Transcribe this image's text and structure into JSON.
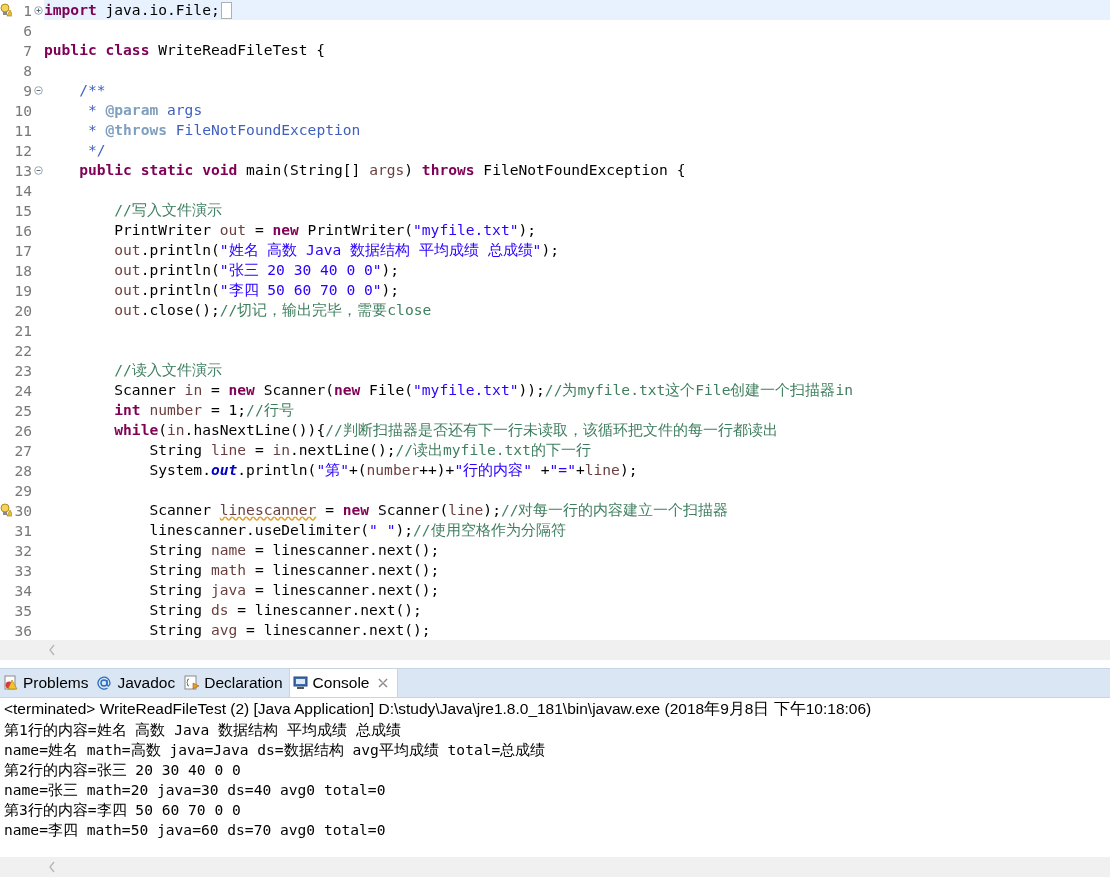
{
  "editor": {
    "lines": [
      {
        "number": "1",
        "folded": true,
        "current": true,
        "warning": true,
        "tokens": [
          {
            "kind": "keyword",
            "text": "import"
          },
          {
            "kind": "plain",
            "text": " java.io.File;"
          }
        ]
      },
      {
        "number": "6",
        "current": false,
        "warning": false
      },
      {
        "number": "7",
        "current": false,
        "warning": false,
        "tokens": [
          {
            "kind": "keyword",
            "text": "public"
          },
          {
            "kind": "keyword",
            "text": " class"
          },
          {
            "kind": "plain",
            "text": " WriteReadFileTest {"
          }
        ]
      },
      {
        "number": "8",
        "current": false,
        "warning": false
      },
      {
        "number": "9",
        "folded": false,
        "current": false,
        "warning": false,
        "tokens": [
          {
            "kind": "doc",
            "text": "    /**"
          }
        ]
      },
      {
        "number": "10",
        "current": false,
        "warning": false,
        "tokens": [
          {
            "kind": "doc",
            "text": "     * "
          },
          {
            "kind": "doctag",
            "text": "@param"
          },
          {
            "kind": "doc",
            "text": " args"
          }
        ]
      },
      {
        "number": "11",
        "current": false,
        "warning": false,
        "tokens": [
          {
            "kind": "doc",
            "text": "     * "
          },
          {
            "kind": "doctag",
            "text": "@throws"
          },
          {
            "kind": "doc",
            "text": " FileNotFoundException"
          }
        ]
      },
      {
        "number": "12",
        "current": false,
        "warning": false,
        "tokens": [
          {
            "kind": "doc",
            "text": "     */"
          }
        ]
      },
      {
        "number": "13",
        "folded": false,
        "current": false,
        "warning": false,
        "tokens": [
          {
            "kind": "keyword",
            "text": "    public"
          },
          {
            "kind": "keyword",
            "text": " static"
          },
          {
            "kind": "keyword",
            "text": " void"
          },
          {
            "kind": "plain",
            "text": " main(String[] "
          },
          {
            "kind": "local",
            "text": "args"
          },
          {
            "kind": "plain",
            "text": ") "
          },
          {
            "kind": "keyword",
            "text": "throws"
          },
          {
            "kind": "plain",
            "text": " FileNotFoundException {"
          }
        ]
      },
      {
        "number": "14",
        "current": false,
        "warning": false
      },
      {
        "number": "15",
        "current": false,
        "warning": false,
        "tokens": [
          {
            "kind": "comment",
            "text": "        //写入文件演示"
          }
        ]
      },
      {
        "number": "16",
        "current": false,
        "warning": false,
        "tokens": [
          {
            "kind": "plain",
            "text": "        PrintWriter "
          },
          {
            "kind": "local",
            "text": "out"
          },
          {
            "kind": "plain",
            "text": " = "
          },
          {
            "kind": "keyword",
            "text": "new"
          },
          {
            "kind": "plain",
            "text": " PrintWriter("
          },
          {
            "kind": "string",
            "text": "\"myfile.txt\""
          },
          {
            "kind": "plain",
            "text": ");"
          }
        ]
      },
      {
        "number": "17",
        "current": false,
        "warning": false,
        "tokens": [
          {
            "kind": "local",
            "text": "        out"
          },
          {
            "kind": "plain",
            "text": ".println("
          },
          {
            "kind": "string",
            "text": "\"姓名 高数 Java 数据结构 平均成绩 总成绩\""
          },
          {
            "kind": "plain",
            "text": ");"
          }
        ]
      },
      {
        "number": "18",
        "current": false,
        "warning": false,
        "tokens": [
          {
            "kind": "local",
            "text": "        out"
          },
          {
            "kind": "plain",
            "text": ".println("
          },
          {
            "kind": "string",
            "text": "\"张三 20 30 40 0 0\""
          },
          {
            "kind": "plain",
            "text": ");"
          }
        ]
      },
      {
        "number": "19",
        "current": false,
        "warning": false,
        "tokens": [
          {
            "kind": "local",
            "text": "        out"
          },
          {
            "kind": "plain",
            "text": ".println("
          },
          {
            "kind": "string",
            "text": "\"李四 50 60 70 0 0\""
          },
          {
            "kind": "plain",
            "text": ");"
          }
        ]
      },
      {
        "number": "20",
        "current": false,
        "warning": false,
        "tokens": [
          {
            "kind": "local",
            "text": "        out"
          },
          {
            "kind": "plain",
            "text": ".close();"
          },
          {
            "kind": "comment",
            "text": "//切记，输出完毕，需要close"
          }
        ]
      },
      {
        "number": "21",
        "current": false,
        "warning": false
      },
      {
        "number": "22",
        "current": false,
        "warning": false
      },
      {
        "number": "23",
        "current": false,
        "warning": false,
        "tokens": [
          {
            "kind": "comment",
            "text": "        //读入文件演示"
          }
        ]
      },
      {
        "number": "24",
        "current": false,
        "warning": false,
        "tokens": [
          {
            "kind": "plain",
            "text": "        Scanner "
          },
          {
            "kind": "local",
            "text": "in"
          },
          {
            "kind": "plain",
            "text": " = "
          },
          {
            "kind": "keyword",
            "text": "new"
          },
          {
            "kind": "plain",
            "text": " Scanner("
          },
          {
            "kind": "keyword",
            "text": "new"
          },
          {
            "kind": "plain",
            "text": " File("
          },
          {
            "kind": "string",
            "text": "\"myfile.txt\""
          },
          {
            "kind": "plain",
            "text": "));"
          },
          {
            "kind": "comment",
            "text": "//为myfile.txt这个File创建一个扫描器in"
          }
        ]
      },
      {
        "number": "25",
        "current": false,
        "warning": false,
        "tokens": [
          {
            "kind": "keyword",
            "text": "        int"
          },
          {
            "kind": "local",
            "text": " number"
          },
          {
            "kind": "plain",
            "text": " = 1;"
          },
          {
            "kind": "comment",
            "text": "//行号"
          }
        ]
      },
      {
        "number": "26",
        "current": false,
        "warning": false,
        "tokens": [
          {
            "kind": "keyword",
            "text": "        while"
          },
          {
            "kind": "plain",
            "text": "("
          },
          {
            "kind": "local",
            "text": "in"
          },
          {
            "kind": "plain",
            "text": ".hasNextLine()){"
          },
          {
            "kind": "comment",
            "text": "//判断扫描器是否还有下一行未读取，该循环把文件的每一行都读出"
          }
        ]
      },
      {
        "number": "27",
        "current": false,
        "warning": false,
        "tokens": [
          {
            "kind": "plain",
            "text": "            String "
          },
          {
            "kind": "local",
            "text": "line"
          },
          {
            "kind": "plain",
            "text": " = "
          },
          {
            "kind": "local",
            "text": "in"
          },
          {
            "kind": "plain",
            "text": ".nextLine();"
          },
          {
            "kind": "comment",
            "text": "//读出myfile.txt的下一行"
          }
        ]
      },
      {
        "number": "28",
        "current": false,
        "warning": false,
        "tokens": [
          {
            "kind": "plain",
            "text": "            System."
          },
          {
            "kind": "field",
            "text": "out"
          },
          {
            "kind": "plain",
            "text": ".println("
          },
          {
            "kind": "string",
            "text": "\"第\""
          },
          {
            "kind": "plain",
            "text": "+("
          },
          {
            "kind": "local",
            "text": "number"
          },
          {
            "kind": "plain",
            "text": "++)+"
          },
          {
            "kind": "string",
            "text": "\"行的内容\""
          },
          {
            "kind": "plain",
            "text": " +"
          },
          {
            "kind": "string",
            "text": "\"=\""
          },
          {
            "kind": "plain",
            "text": "+"
          },
          {
            "kind": "local",
            "text": "line"
          },
          {
            "kind": "plain",
            "text": ");"
          }
        ]
      },
      {
        "number": "29",
        "current": false,
        "warning": false
      },
      {
        "number": "30",
        "current": false,
        "warning": true,
        "tokens": [
          {
            "kind": "plain",
            "text": "            Scanner "
          },
          {
            "kind": "unused",
            "text": "linescanner"
          },
          {
            "kind": "plain",
            "text": " = "
          },
          {
            "kind": "keyword",
            "text": "new"
          },
          {
            "kind": "plain",
            "text": " Scanner("
          },
          {
            "kind": "local",
            "text": "line"
          },
          {
            "kind": "plain",
            "text": ");"
          },
          {
            "kind": "comment",
            "text": "//对每一行的内容建立一个扫描器"
          }
        ]
      },
      {
        "number": "31",
        "current": false,
        "warning": false,
        "tokens": [
          {
            "kind": "plain",
            "text": "            linescanner.useDelimiter("
          },
          {
            "kind": "string",
            "text": "\" \""
          },
          {
            "kind": "plain",
            "text": ");"
          },
          {
            "kind": "comment",
            "text": "//使用空格作为分隔符"
          }
        ]
      },
      {
        "number": "32",
        "current": false,
        "warning": false,
        "tokens": [
          {
            "kind": "plain",
            "text": "            String "
          },
          {
            "kind": "local",
            "text": "name"
          },
          {
            "kind": "plain",
            "text": " = linescanner.next();"
          }
        ]
      },
      {
        "number": "33",
        "current": false,
        "warning": false,
        "tokens": [
          {
            "kind": "plain",
            "text": "            String "
          },
          {
            "kind": "local",
            "text": "math"
          },
          {
            "kind": "plain",
            "text": " = linescanner.next();"
          }
        ]
      },
      {
        "number": "34",
        "current": false,
        "warning": false,
        "tokens": [
          {
            "kind": "plain",
            "text": "            String "
          },
          {
            "kind": "local",
            "text": "java"
          },
          {
            "kind": "plain",
            "text": " = linescanner.next();"
          }
        ]
      },
      {
        "number": "35",
        "current": false,
        "warning": false,
        "tokens": [
          {
            "kind": "plain",
            "text": "            String "
          },
          {
            "kind": "local",
            "text": "ds"
          },
          {
            "kind": "plain",
            "text": " = linescanner.next();"
          }
        ]
      },
      {
        "number": "36",
        "current": false,
        "warning": false,
        "tokens": [
          {
            "kind": "plain",
            "text": "            String "
          },
          {
            "kind": "local",
            "text": "avg"
          },
          {
            "kind": "plain",
            "text": " = linescanner.next();"
          }
        ]
      }
    ]
  },
  "tabs": [
    {
      "label": "Problems",
      "selected": false,
      "closable": false
    },
    {
      "label": "Javadoc",
      "selected": false,
      "closable": false
    },
    {
      "label": "Declaration",
      "selected": false,
      "closable": false
    },
    {
      "label": "Console",
      "selected": true,
      "closable": true
    }
  ],
  "console": {
    "header": "<terminated> WriteReadFileTest (2) [Java Application] D:\\study\\Java\\jre1.8.0_181\\bin\\javaw.exe (2018年9月8日 下午10:18:06)",
    "lines": [
      "第1行的内容=姓名 高数 Java 数据结构 平均成绩 总成绩",
      "name=姓名 math=高数 java=Java ds=数据结构 avg平均成绩 total=总成绩",
      "第2行的内容=张三 20 30 40 0 0",
      "name=张三 math=20 java=30 ds=40 avg0 total=0",
      "第3行的内容=李四 50 60 70 0 0",
      "name=李四 math=50 java=60 ds=70 avg0 total=0"
    ]
  }
}
